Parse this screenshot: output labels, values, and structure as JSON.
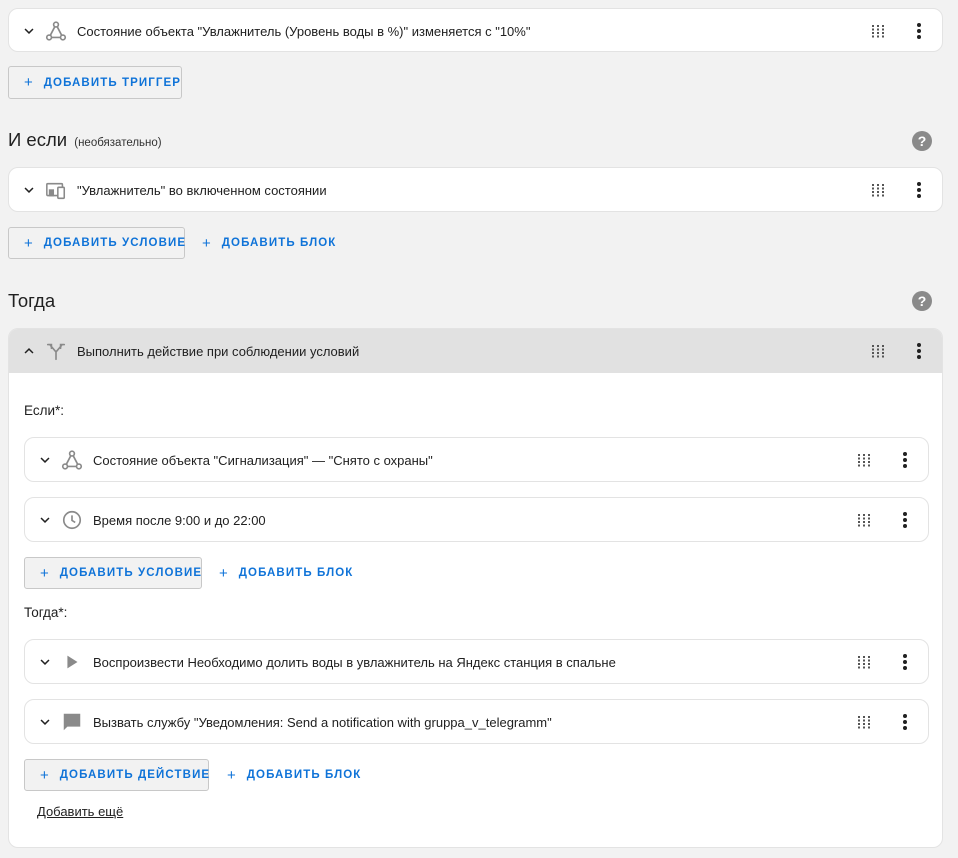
{
  "colors": {
    "accent": "#0f73d8",
    "icon": "#8a8a8a",
    "header_bg": "#e1e1e1"
  },
  "triggers": {
    "item1": {
      "icon": "trigger-state-icon",
      "label": "Состояние объекта \"Увлажнитель (Уровень воды в %)\" изменяется с \"10%\""
    },
    "add_trigger": "ДОБАВИТЬ ТРИГГЕР"
  },
  "conditions": {
    "title": "И если",
    "subtitle": "(необязательно)",
    "item1": {
      "icon": "device-icon",
      "label": "\"Увлажнитель\" во включенном состоянии"
    },
    "add_condition": "ДОБАВИТЬ УСЛОВИЕ",
    "add_block": "ДОБАВИТЬ БЛОК"
  },
  "actions": {
    "title": "Тогда",
    "block": {
      "icon": "branch-icon",
      "label": "Выполнить действие при соблюдении условий",
      "if_label": "Если*:",
      "if_items": [
        {
          "icon": "trigger-state-icon",
          "label": "Состояние объекта \"Сигнализация\" — \"Снято с охраны\""
        },
        {
          "icon": "clock-icon",
          "label": "Время после 9:00 и до 22:00"
        }
      ],
      "add_condition": "ДОБАВИТЬ УСЛОВИЕ",
      "add_block": "ДОБАВИТЬ БЛОК",
      "then_label": "Тогда*:",
      "then_items": [
        {
          "icon": "play-icon",
          "label": "Воспроизвести Необходимо долить воды в увлажнитель на Яндекс станция в спальне"
        },
        {
          "icon": "message-icon",
          "label": "Вызвать службу \"Уведомления: Send a notification with gruppa_v_telegramm\""
        }
      ],
      "add_action": "ДОБАВИТЬ ДЕЙСТВИЕ",
      "add_block2": "ДОБАВИТЬ БЛОК",
      "add_more": "Добавить ещё"
    }
  },
  "help_glyph": "?",
  "plus_glyph": "+"
}
